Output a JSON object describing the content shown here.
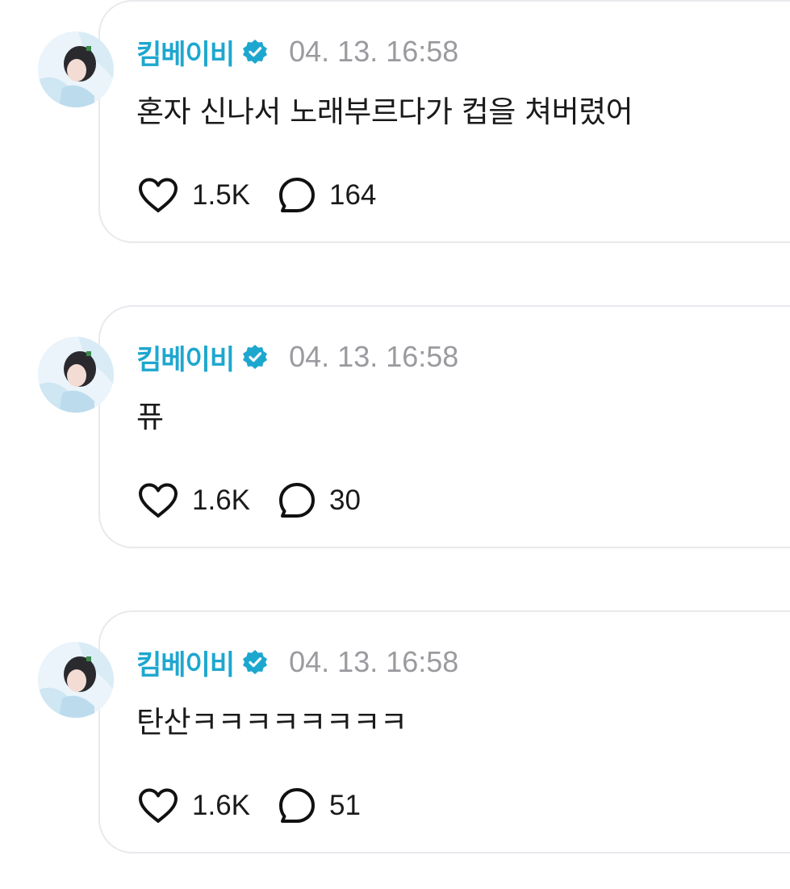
{
  "accent": "#1da7cf",
  "posts": [
    {
      "author": "킴베이비",
      "verified_icon": "verified-badge-icon",
      "timestamp": "04. 13. 16:58",
      "text": "혼자 신나서 노래부르다가 컵을 쳐버렸어",
      "likes": "1.5K",
      "replies": "164"
    },
    {
      "author": "킴베이비",
      "verified_icon": "verified-badge-icon",
      "timestamp": "04. 13. 16:58",
      "text": "퓨",
      "likes": "1.6K",
      "replies": "30"
    },
    {
      "author": "킴베이비",
      "verified_icon": "verified-badge-icon",
      "timestamp": "04. 13. 16:58",
      "text": "탄산ㅋㅋㅋㅋㅋㅋㅋㅋ",
      "likes": "1.6K",
      "replies": "51"
    }
  ]
}
